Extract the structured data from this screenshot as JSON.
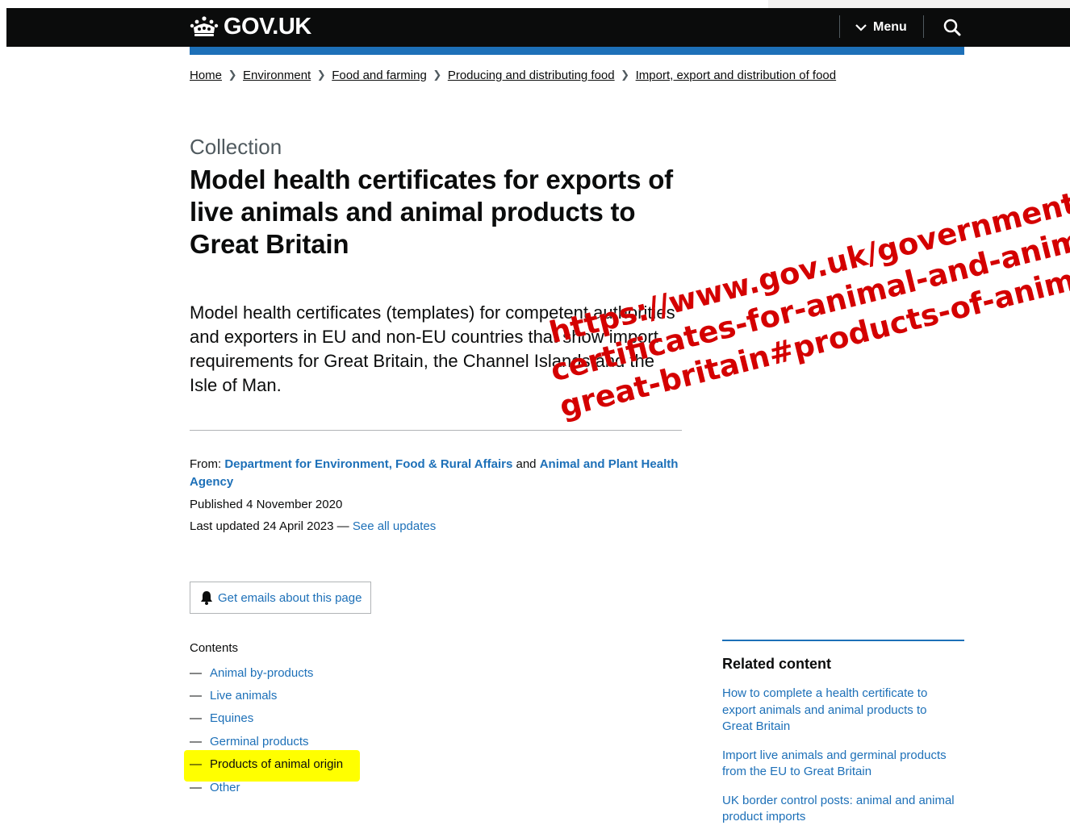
{
  "header": {
    "logo_text": "GOV.UK",
    "menu_label": "Menu"
  },
  "breadcrumbs": [
    "Home",
    "Environment",
    "Food and farming",
    "Producing and distributing food",
    "Import, export and distribution of food"
  ],
  "caption": "Collection",
  "title": "Model health certificates for exports of live animals and animal products to Great Britain",
  "lede": "Model health certificates (templates) for competent authorities and exporters in EU and non-EU countries that show import requirements for Great Britain, the Channel Islands and the Isle of Man.",
  "meta": {
    "from_label": "From:",
    "org1": "Department for Environment, Food & Rural Affairs",
    "and_word": "and",
    "org2": "Animal and Plant Health Agency",
    "published_label": "Published",
    "published_date": "4 November 2020",
    "updated_label": "Last updated",
    "updated_date": "24 April 2023",
    "updated_sep": "—",
    "see_updates": "See all updates"
  },
  "email_button": "Get emails about this page",
  "contents": {
    "heading": "Contents",
    "dash": "—",
    "items": [
      "Animal by-products",
      "Live animals",
      "Equines",
      "Germinal products",
      "Products of animal origin",
      "Other"
    ]
  },
  "related": {
    "title": "Related content",
    "links": [
      "How to complete a health certificate to export animals and animal products to Great Britain",
      "Import live animals and germinal products from the EU to Great Britain",
      "UK border control posts: animal and animal product imports"
    ]
  },
  "overlay": {
    "lines": [
      "https://www.gov.uk/government/collec",
      "certificates-for-animal-and-animal-pro",
      "great-britain#products-of-animal-orig"
    ],
    "color": "#d40000"
  },
  "colors": {
    "link": "#1d70b8",
    "header_bg": "#0b0c0c",
    "highlight": "#ffff00"
  }
}
